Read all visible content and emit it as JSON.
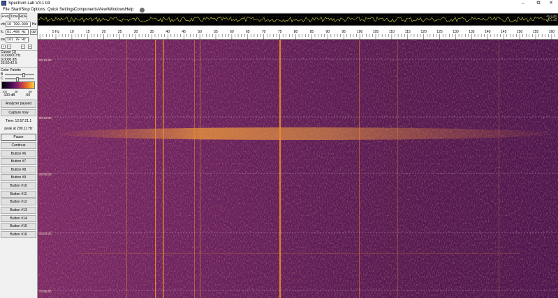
{
  "app": {
    "title": "Spectrum Lab V3.1 b3"
  },
  "window_controls": {
    "minimize": "–",
    "maximize": "⧉",
    "close": "✕"
  },
  "menu": [
    "File",
    "Start/Stop",
    "Options",
    "Quick Settings",
    "Components",
    "View/Windows",
    "Help"
  ],
  "left_panel": {
    "tabs": [
      "Freq",
      "Time",
      "RDF"
    ],
    "vfo": {
      "label": "vfo",
      "value": "10 700.000",
      "unit": "Hz"
    },
    "fc": {
      "label": "fc",
      "value": "81.408 Hz",
      "unit": "opt"
    },
    "sw": {
      "label": "sw",
      "value": "161.7E Hz"
    },
    "arrow_buttons": [
      "«",
      "‹",
      "›",
      "»"
    ],
    "cursor": {
      "title": "Cursor [1]",
      "freq": "0.000000 Hz",
      "level": "0.0000 dB",
      "time": "23:50:42.5"
    },
    "palette": {
      "title": "Color Palette",
      "b_label": "B",
      "c_label": "C",
      "b_level": 0.62,
      "c_level": 0.4,
      "ticks": [
        "-100",
        "-80",
        "-60"
      ],
      "min_label": "-100 dB",
      "max_label": "-50"
    },
    "analyzer_status": "Analyzer paused",
    "capture_button": "Capture now",
    "time_text": "Time: 12:57:21.1",
    "peak_text": "peak at 290.11 Hz",
    "pause_button": "Pause",
    "buttons": [
      "Continue",
      "Button #6",
      "Button #7",
      "Button #8",
      "Button #9",
      "Button #10",
      "Button #11",
      "Button #12",
      "Button #13",
      "Button #14",
      "Button #15",
      "Button #16"
    ]
  },
  "spectrum": {
    "db_top": "-60.0 dB",
    "db_bottom": "-70.0 dB"
  },
  "scale": {
    "ticks": [
      "5 Hz",
      "10",
      "15",
      "20",
      "25",
      "30",
      "35",
      "40",
      "45",
      "50",
      "55",
      "60",
      "65",
      "70",
      "75",
      "80",
      "85",
      "90",
      "95",
      "100",
      "105",
      "110",
      "115",
      "120",
      "125",
      "130",
      "135",
      "140",
      "145",
      "150",
      "155",
      "160"
    ]
  },
  "waterfall": {
    "time_labels": [
      "00:15:00",
      "00:10:00",
      "00:05:00",
      "00:00:00",
      "23:55:00"
    ],
    "colors": {
      "background": "#5c1a54",
      "trace": "#ef8a2a",
      "bright": "#fbd34a"
    }
  }
}
